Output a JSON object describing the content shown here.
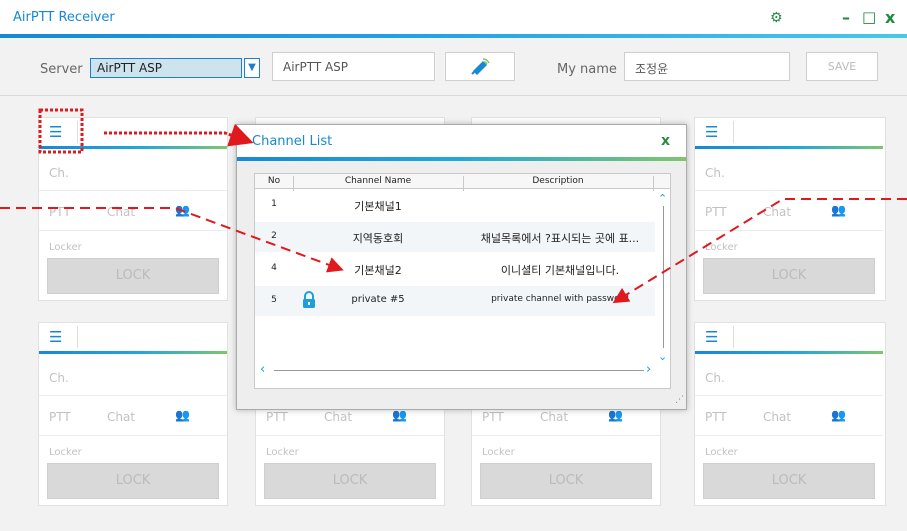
{
  "window": {
    "title": "AirPTT Receiver",
    "controls": {
      "settings_icon": "gear-icon",
      "minimize": "–",
      "maximize": "□",
      "close": "x"
    }
  },
  "server_bar": {
    "server_label": "Server",
    "server_selected": "AirPTT ASP",
    "server_name_field": "AirPTT ASP",
    "my_name_label": "My name",
    "my_name_value": "조정윤",
    "save_label": "SAVE"
  },
  "panel_labels": {
    "ch": "Ch.",
    "ptt": "PTT",
    "chat": "Chat",
    "locker": "Locker",
    "lock": "LOCK"
  },
  "channel_dialog": {
    "title": "Channel List",
    "close": "x",
    "columns": {
      "no": "No",
      "name": "Channel Name",
      "description": "Description"
    },
    "rows": [
      {
        "no": "1",
        "name": "기본채널1",
        "description": ""
      },
      {
        "no": "2",
        "name": "지역동호회",
        "description": "채널목록에서 ?표시되는 곳에 표..."
      },
      {
        "no": "4",
        "name": "기본채널2",
        "description": "이니셜티 기본채널입니다."
      },
      {
        "no": "5",
        "name": "private #5",
        "description": "private channel with password",
        "locked": true
      }
    ]
  },
  "colors": {
    "accent_blue": "#1689d4",
    "accent_green": "#7ec66c",
    "annotation_red": "#e0191e",
    "lock_icon": "#1f9fd8"
  }
}
